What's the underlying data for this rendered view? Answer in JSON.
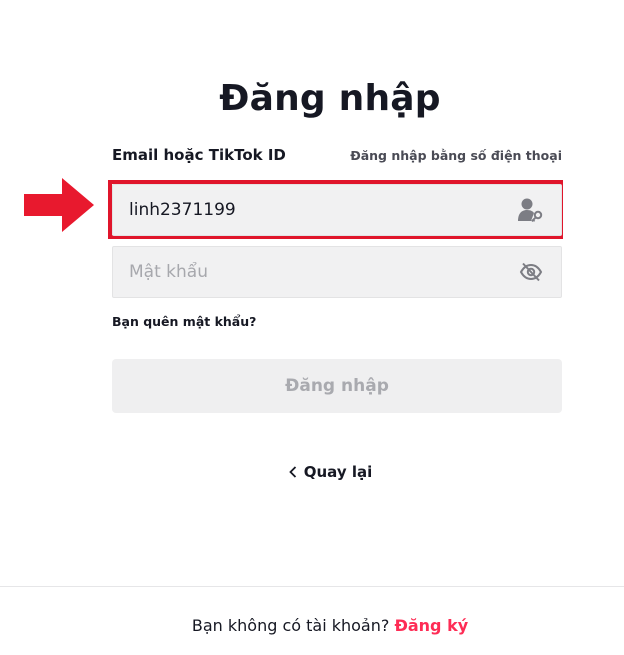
{
  "page": {
    "title": "Đăng nhập"
  },
  "form": {
    "field_label": "Email hoặc TikTok ID",
    "phone_login_link": "Đăng nhập bằng số điện thoại",
    "username_value": "linh2371199",
    "password_placeholder": "Mật khẩu",
    "forgot_password": "Bạn quên mật khẩu?",
    "login_button": "Đăng nhập",
    "back_link": "Quay lại"
  },
  "footer": {
    "no_account_text": "Bạn không có tài khoản? ",
    "signup_link": "Đăng ký"
  },
  "icons": {
    "username": "user-key-icon",
    "password": "eye-off-icon",
    "back": "chevron-left-icon",
    "annotation": "red-arrow-icon"
  },
  "colors": {
    "accent": "#fe2c55",
    "highlight": "#e0152b",
    "input_bg": "#f1f1f2",
    "button_disabled_bg": "#efeff0",
    "button_disabled_text": "#a9aaaf"
  }
}
